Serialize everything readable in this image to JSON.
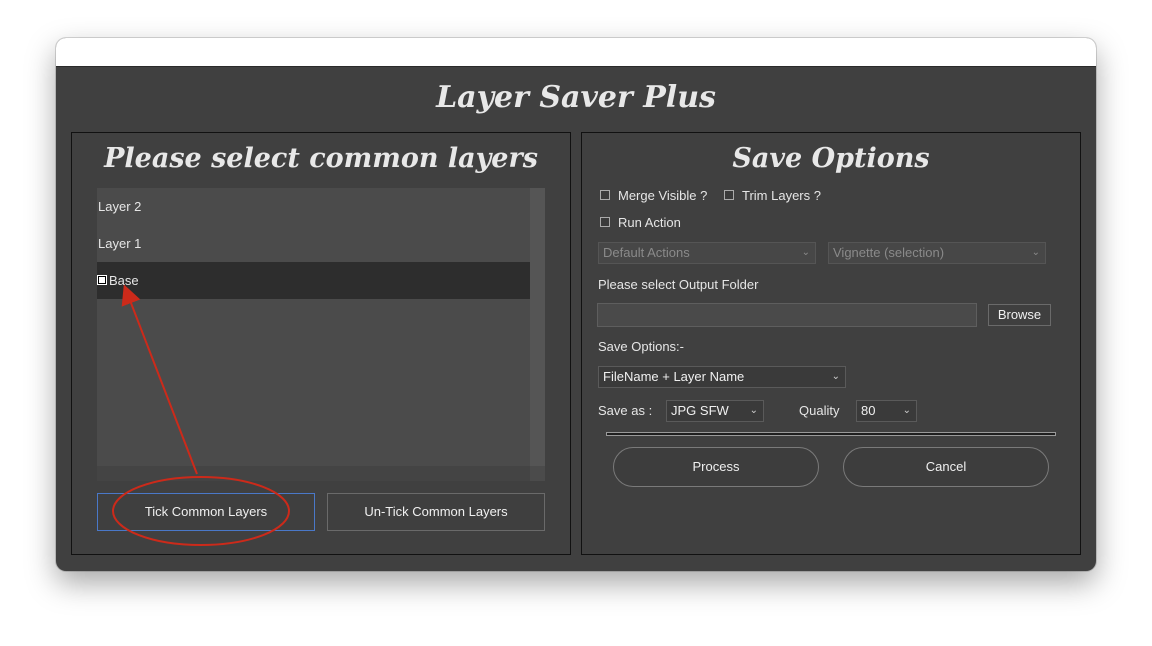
{
  "app": {
    "title": "Layer Saver Plus"
  },
  "left_panel": {
    "title": "Please select common layers",
    "layers": [
      {
        "label": "Layer 2",
        "selected": false,
        "ticked": false
      },
      {
        "label": "Layer 1",
        "selected": false,
        "ticked": false
      },
      {
        "label": "Base",
        "selected": true,
        "ticked": true
      }
    ],
    "tick_button": "Tick Common Layers",
    "untick_button": "Un-Tick Common Layers"
  },
  "right_panel": {
    "title": "Save Options",
    "merge_visible": {
      "label": "Merge Visible ?",
      "checked": false
    },
    "trim_layers": {
      "label": "Trim Layers ?",
      "checked": false
    },
    "run_action": {
      "label": "Run Action",
      "checked": false
    },
    "action_set": {
      "value": "Default Actions",
      "disabled": true
    },
    "action": {
      "value": "Vignette (selection)",
      "disabled": true
    },
    "output_folder_label": "Please select Output Folder",
    "output_folder_value": "",
    "browse_button": "Browse",
    "save_options_label": "Save Options:-",
    "save_options_select": "FileName + Layer Name",
    "save_as_label": "Save as :",
    "save_as_select": "JPG SFW",
    "quality_label": "Quality",
    "quality_select": "80",
    "process_button": "Process",
    "cancel_button": "Cancel"
  },
  "colors": {
    "window_bg": "#404040",
    "annotation": "#cc2a1a",
    "focus_border": "#4a78c8"
  },
  "icons": {
    "dropdown": "chevron-down-icon"
  }
}
